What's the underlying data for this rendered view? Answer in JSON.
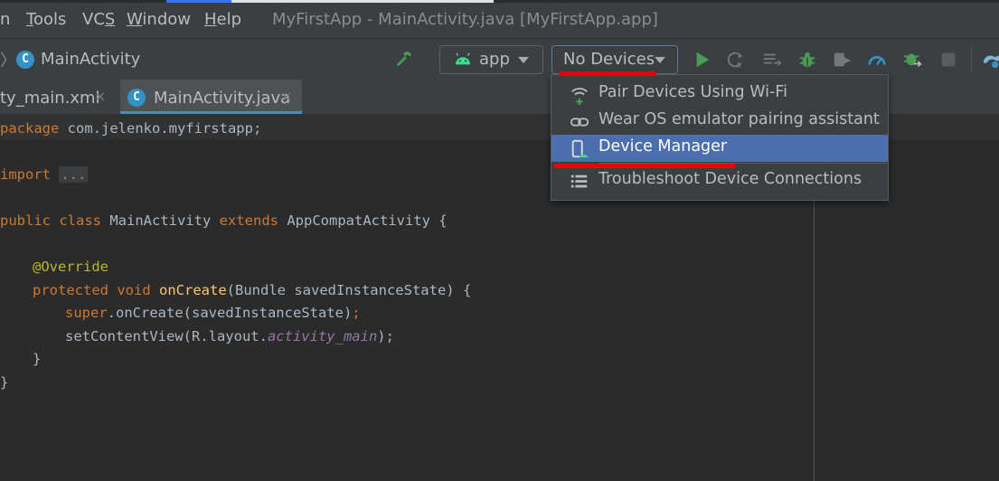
{
  "menu": {
    "items": [
      {
        "pre": "",
        "u": "",
        "post": "n"
      },
      {
        "pre": "",
        "u": "T",
        "post": "ools"
      },
      {
        "pre": "VC",
        "u": "S",
        "post": ""
      },
      {
        "pre": "",
        "u": "W",
        "post": "indow"
      },
      {
        "pre": "",
        "u": "H",
        "post": "elp"
      }
    ],
    "window_title": "MyFirstApp - MainActivity.java [MyFirstApp.app]"
  },
  "toolbar": {
    "breadcrumb_chevron": "〉",
    "class_icon_letter": "C",
    "breadcrumb_label": "MainActivity",
    "run_config": "app",
    "device_selector": "No Devices"
  },
  "tabs": [
    {
      "label": "ty_main.xml",
      "close": "×"
    },
    {
      "label": "MainActivity.java",
      "close": "×",
      "icon_letter": "C"
    }
  ],
  "editor": {
    "package_kw": "package",
    "package_name": " com.jelenko.myfirstapp;",
    "import_kw": "import",
    "import_fold": "...",
    "class_public": "public",
    "class_class": "class",
    "class_name": " MainActivity ",
    "class_extends": "extends",
    "class_rest": " AppCompatActivity {",
    "annotation": "@Override",
    "method_protected": "protected",
    "method_void": "void",
    "method_name": "onCreate",
    "method_rest": "(Bundle savedInstanceState) {",
    "super_kw": "super",
    "super_rest": ".onCreate(savedInstanceState)",
    "semicolon": ";",
    "setcontent_pre": "setContentView(R.layout.",
    "setcontent_field": "activity_main",
    "setcontent_post": ");",
    "close_inner": "}",
    "close_outer": "}"
  },
  "dropdown": {
    "items": [
      {
        "label": "Pair Devices Using Wi-Fi",
        "icon": "wifi-plus-icon",
        "selected": false
      },
      {
        "label": "Wear OS emulator pairing assistant",
        "icon": "link-icon",
        "selected": false
      },
      {
        "label": "Device Manager",
        "icon": "device-manager-icon",
        "selected": true
      },
      {
        "label": "Troubleshoot Device Connections",
        "icon": "list-icon",
        "selected": false
      }
    ]
  },
  "colors": {
    "accent_blue": "#4b6eaf",
    "run_green": "#499c54",
    "annotation_red": "#e8000d"
  }
}
